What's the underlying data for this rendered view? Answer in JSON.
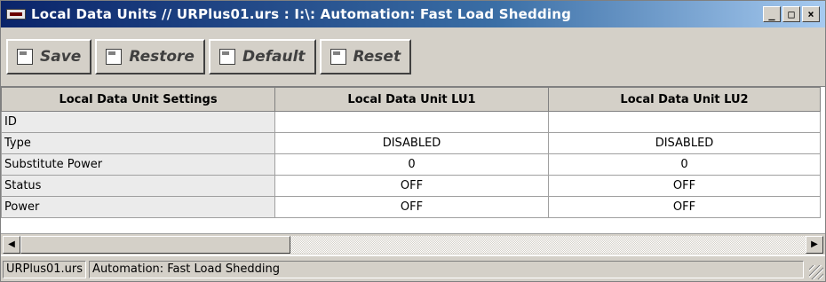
{
  "window": {
    "title": "Local Data Units // URPlus01.urs : I:\\: Automation: Fast Load Shedding",
    "controls": [
      "_",
      "□",
      "×"
    ]
  },
  "toolbar": {
    "buttons": [
      {
        "label": "Save",
        "icon": "save-icon"
      },
      {
        "label": "Restore",
        "icon": "restore-icon"
      },
      {
        "label": "Default",
        "icon": "default-icon"
      },
      {
        "label": "Reset",
        "icon": "reset-icon"
      }
    ]
  },
  "table": {
    "headers": [
      "Local Data Unit Settings",
      "Local Data Unit LU1",
      "Local Data Unit LU2"
    ],
    "rows": [
      {
        "label": "ID",
        "lu1": "",
        "lu2": ""
      },
      {
        "label": "Type",
        "lu1": "DISABLED",
        "lu2": "DISABLED"
      },
      {
        "label": "Substitute Power",
        "lu1": "0",
        "lu2": "0"
      },
      {
        "label": "Status",
        "lu1": "OFF",
        "lu2": "OFF"
      },
      {
        "label": "Power",
        "lu1": "OFF",
        "lu2": "OFF"
      }
    ]
  },
  "scrollbar": {
    "left_arrow": "◀",
    "right_arrow": "▶"
  },
  "statusbar": {
    "file": "URPlus01.urs",
    "path": "Automation: Fast Load Shedding"
  },
  "colors": {
    "title_start": "#0a246a",
    "title_end": "#a6caf0",
    "face": "#d4d0c8"
  }
}
